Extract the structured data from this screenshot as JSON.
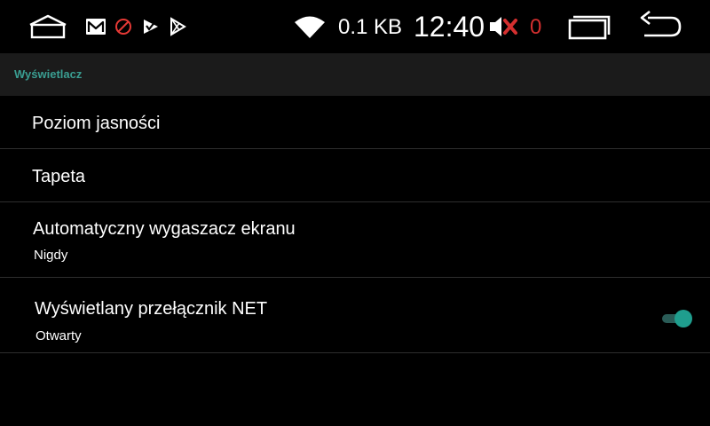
{
  "status_bar": {
    "net_speed": "0.1 KB",
    "time": "12:40",
    "mute_count": "0",
    "icons": {
      "home": "home-icon",
      "notifications": [
        "gmail-icon",
        "blocked-icon",
        "checkmark-play-icon",
        "play-store-icon"
      ],
      "wifi": "wifi-icon",
      "mute": "volume-muted-icon",
      "recents": "recent-apps-icon",
      "back": "back-icon"
    },
    "colors": {
      "mute_accent": "#d32f2f"
    }
  },
  "section": {
    "title": "Wyświetlacz",
    "accent_color": "#3a9e92"
  },
  "settings": [
    {
      "title": "Poziom jasności"
    },
    {
      "title": "Tapeta"
    },
    {
      "title": "Automatyczny wygaszacz ekranu",
      "summary": "Nigdy"
    },
    {
      "title": "Wyświetlany przełącznik NET",
      "summary": "Otwarty",
      "toggle_on": true
    }
  ],
  "colors": {
    "background": "#000000",
    "section_header_bg": "#1b1b1b",
    "divider": "#2e2e2e",
    "switch_on": "#1f9e8e"
  }
}
